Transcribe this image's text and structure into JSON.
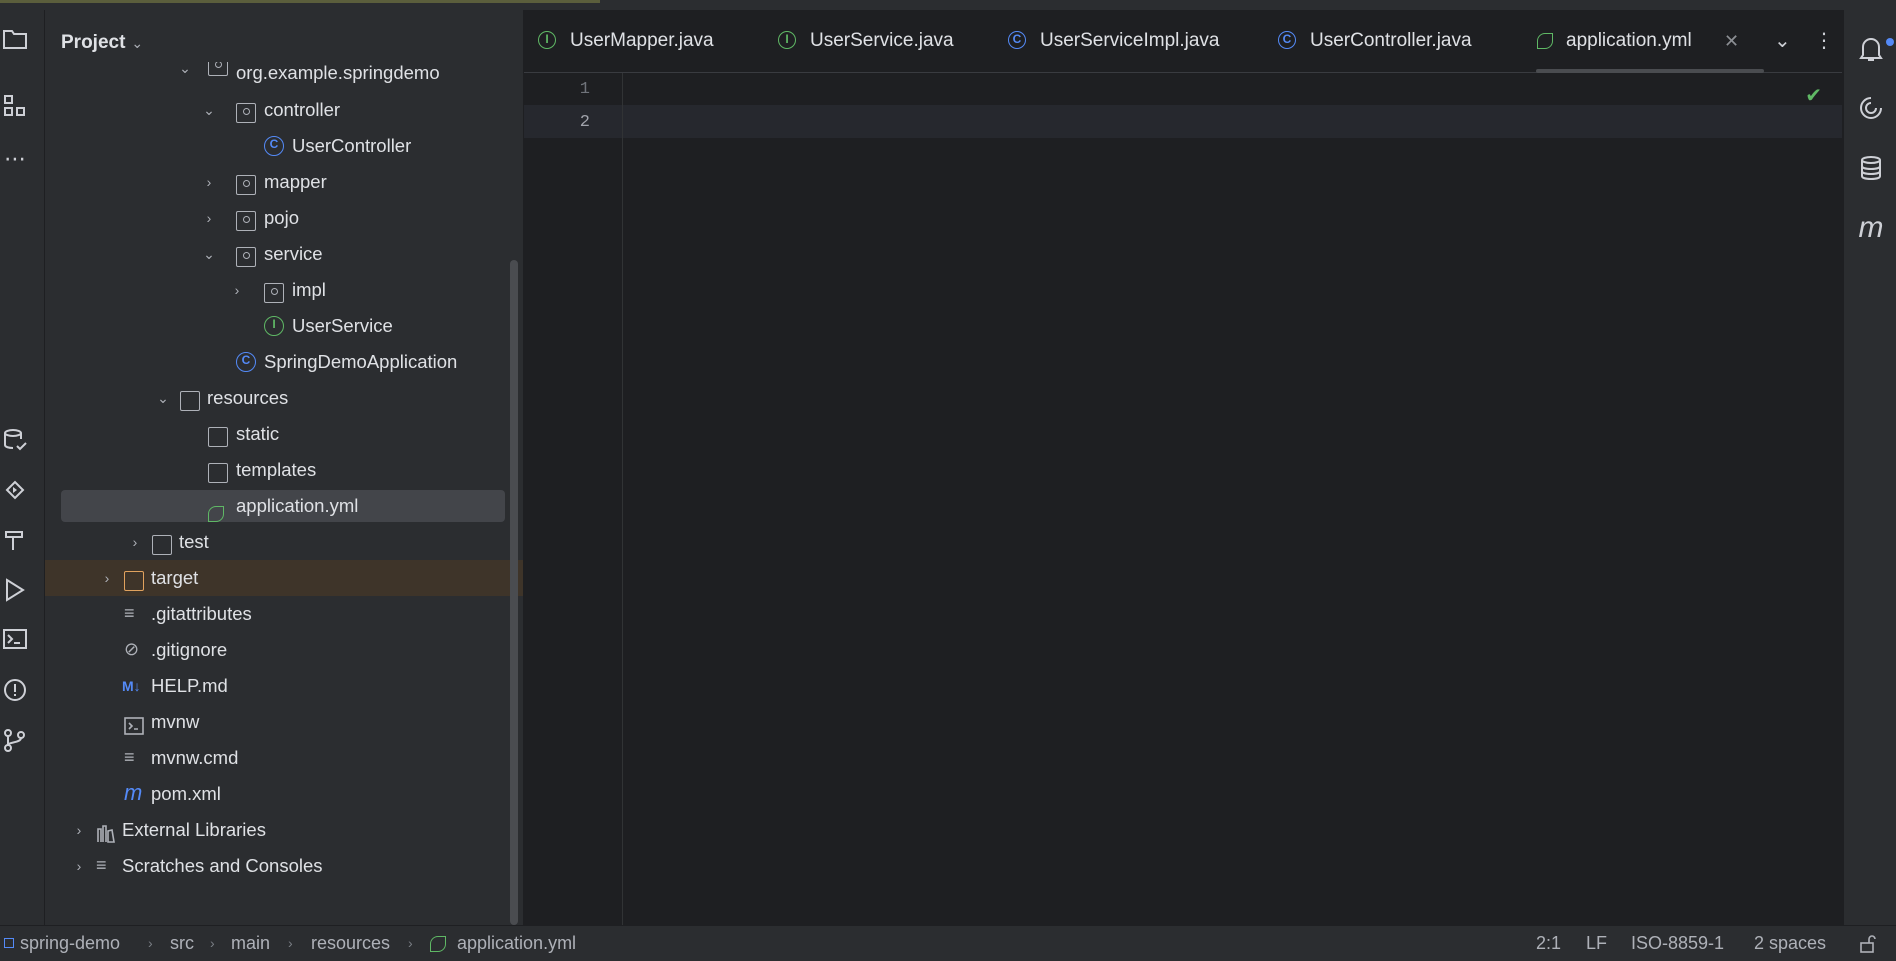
{
  "project_panel": {
    "title": "Project",
    "tree": [
      {
        "label": "org.example.springdemo",
        "kind": "package"
      },
      {
        "label": "controller",
        "kind": "package"
      },
      {
        "label": "UserController",
        "kind": "class"
      },
      {
        "label": "mapper",
        "kind": "package"
      },
      {
        "label": "pojo",
        "kind": "package"
      },
      {
        "label": "service",
        "kind": "package"
      },
      {
        "label": "impl",
        "kind": "package"
      },
      {
        "label": "UserService",
        "kind": "interface"
      },
      {
        "label": "SpringDemoApplication",
        "kind": "spring-class"
      },
      {
        "label": "resources",
        "kind": "resource-folder"
      },
      {
        "label": "static",
        "kind": "folder"
      },
      {
        "label": "templates",
        "kind": "folder"
      },
      {
        "label": "application.yml",
        "kind": "spring-config",
        "selected": true
      },
      {
        "label": "test",
        "kind": "folder"
      },
      {
        "label": "target",
        "kind": "excluded-folder"
      },
      {
        "label": ".gitattributes",
        "kind": "text-file"
      },
      {
        "label": ".gitignore",
        "kind": "ignore-file"
      },
      {
        "label": "HELP.md",
        "kind": "markdown-file"
      },
      {
        "label": "mvnw",
        "kind": "script-file"
      },
      {
        "label": "mvnw.cmd",
        "kind": "text-file"
      },
      {
        "label": "pom.xml",
        "kind": "maven-file"
      },
      {
        "label": "External Libraries",
        "kind": "libraries"
      },
      {
        "label": "Scratches and Consoles",
        "kind": "scratches"
      }
    ]
  },
  "tabs": [
    {
      "label": "UserMapper.java",
      "kind": "interface"
    },
    {
      "label": "UserService.java",
      "kind": "interface"
    },
    {
      "label": "UserServiceImpl.java",
      "kind": "class"
    },
    {
      "label": "UserController.java",
      "kind": "class"
    },
    {
      "label": "application.yml",
      "kind": "spring-config",
      "active": true
    }
  ],
  "editor": {
    "line_numbers": [
      "1",
      "2"
    ],
    "current_line": 2
  },
  "breadcrumbs": [
    "spring-demo",
    "src",
    "main",
    "resources",
    "application.yml"
  ],
  "status": {
    "position": "2:1",
    "line_separator": "LF",
    "encoding": "ISO-8859-1",
    "indent": "2 spaces"
  },
  "icons": {
    "md_badge": "M↓",
    "maven_badge": "m",
    "class_letter": "C",
    "interface_letter": "I"
  },
  "colors": {
    "accent_blue": "#548af7",
    "interface_green": "#5fb865",
    "excluded_orange": "#e0a25e"
  }
}
